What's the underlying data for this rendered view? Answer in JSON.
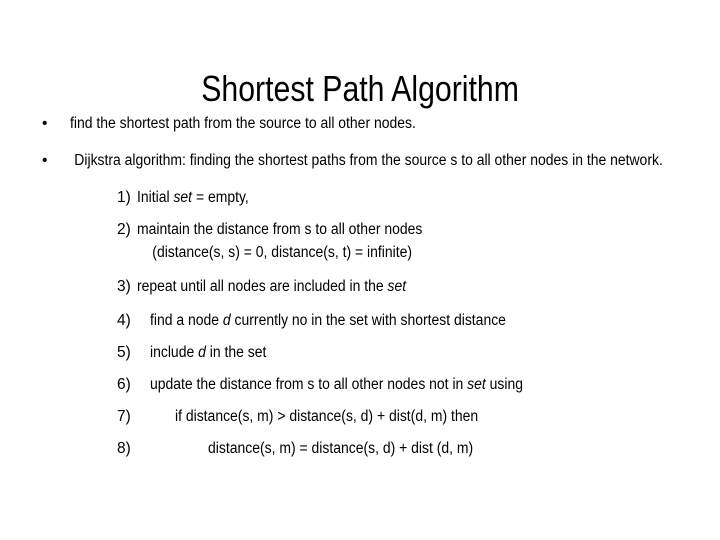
{
  "slide": {
    "title": "Shortest Path Algorithm",
    "background_color": "#ffffff",
    "text_color": "#000000"
  },
  "bullets": [
    {
      "marker": "•",
      "text": "find the shortest path from the source to all other nodes."
    },
    {
      "marker": "•",
      "text": " Dijkstra algorithm: finding  the shortest paths from  the  source s to all other nodes in the network."
    }
  ],
  "steps": [
    {
      "number": "1)",
      "text_before": "Initial ",
      "italic": "set",
      "text_after": " = empty,",
      "sub": ""
    },
    {
      "number": "2)",
      "text_before": "maintain the distance from s to all other nodes",
      "italic": "",
      "text_after": "",
      "sub": "(distance(s, s) = 0, distance(s, t) = infinite)"
    },
    {
      "number": "3)",
      "text_before": "repeat until all nodes are included in the ",
      "italic": "set",
      "text_after": "",
      "sub": ""
    },
    {
      "number": "4)",
      "text_before": "find a node ",
      "italic": "d",
      "text_after": " currently no in the set with shortest distance",
      "sub": ""
    },
    {
      "number": "5)",
      "text_before": "include ",
      "italic": "d",
      "text_after": " in the set",
      "sub": ""
    },
    {
      "number": "6)",
      "text_before": "update the distance from s to all other nodes not in ",
      "italic": "set",
      "text_after": " using",
      "sub": ""
    },
    {
      "number": "7)",
      "text_before": "if distance(s, m) > distance(s, d) + dist(d, m) then",
      "italic": "",
      "text_after": "",
      "sub": ""
    },
    {
      "number": "8)",
      "text_before": "distance(s, m) = distance(s, d) + dist (d, m)",
      "italic": "",
      "text_after": "",
      "sub": ""
    }
  ]
}
